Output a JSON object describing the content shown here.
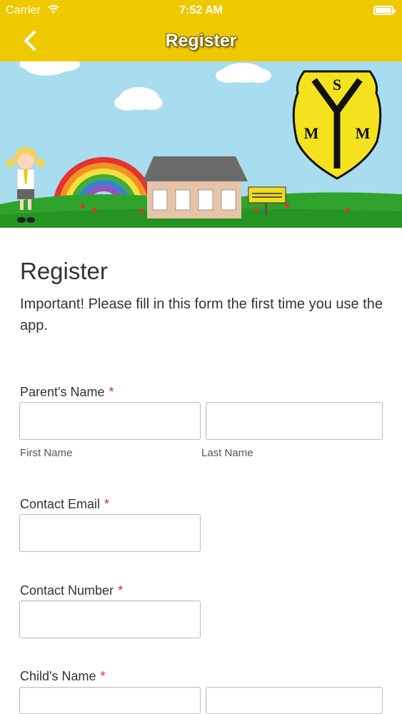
{
  "status_bar": {
    "carrier": "Carrier",
    "time": "7:52 AM"
  },
  "nav": {
    "title": "Register",
    "back_icon": "chevron-left-icon"
  },
  "banner": {
    "sign_text": "St Margaret Mary's Catholic Infant School",
    "crest_letters": [
      "S",
      "M",
      "M"
    ]
  },
  "form": {
    "title": "Register",
    "description": "Important! Please fill in this form the first time you use the app.",
    "required_marker": "*",
    "fields": {
      "parent_name": {
        "label": "Parent's Name",
        "first_sublabel": "First Name",
        "last_sublabel": "Last Name",
        "first_value": "",
        "last_value": ""
      },
      "contact_email": {
        "label": "Contact Email",
        "value": ""
      },
      "contact_number": {
        "label": "Contact Number",
        "value": ""
      },
      "child_name": {
        "label": "Child's Name",
        "first_value": "",
        "last_value": ""
      }
    }
  },
  "colors": {
    "header": "#efc900",
    "required": "#d32f2f",
    "text": "#333333",
    "sky": "#a8dcef",
    "grass": "#2fa32b"
  }
}
